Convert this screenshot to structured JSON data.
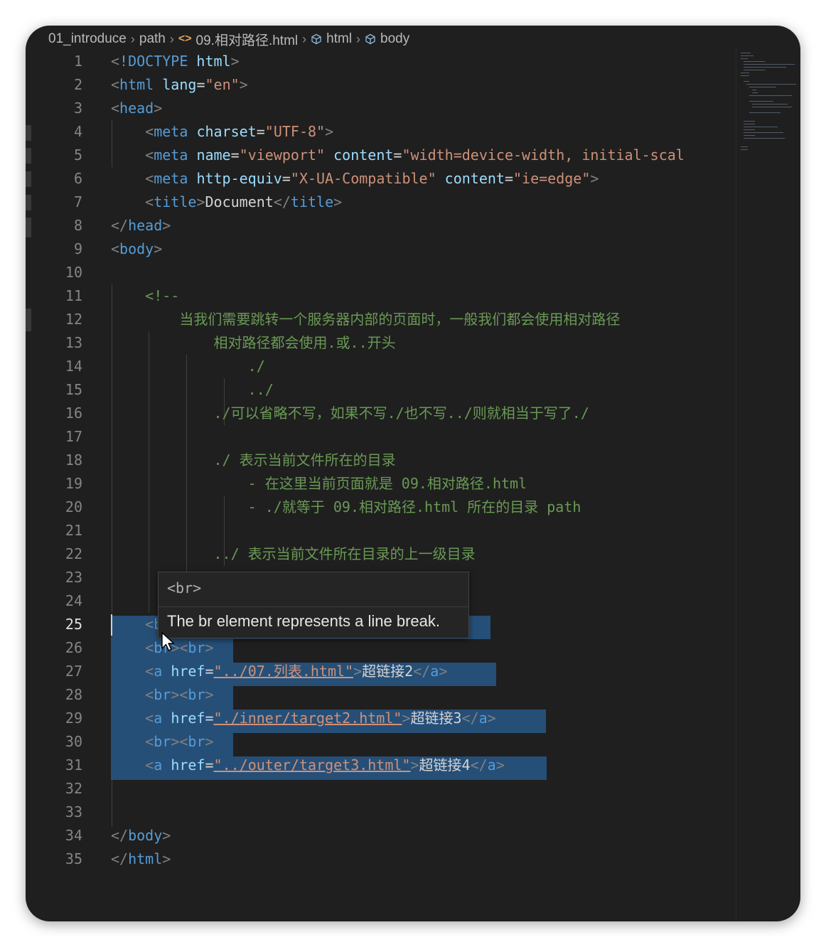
{
  "breadcrumb": {
    "items": [
      "01_introduce",
      "path",
      "09.相对路径.html",
      "html",
      "body"
    ]
  },
  "editor": {
    "active_line": 25,
    "lines": [
      {
        "n": "1"
      },
      {
        "n": "2"
      },
      {
        "n": "3"
      },
      {
        "n": "4"
      },
      {
        "n": "5"
      },
      {
        "n": "6"
      },
      {
        "n": "7"
      },
      {
        "n": "8"
      },
      {
        "n": "9"
      },
      {
        "n": "10"
      },
      {
        "n": "11"
      },
      {
        "n": "12"
      },
      {
        "n": "13"
      },
      {
        "n": "14"
      },
      {
        "n": "15"
      },
      {
        "n": "16"
      },
      {
        "n": "17"
      },
      {
        "n": "18"
      },
      {
        "n": "19"
      },
      {
        "n": "20"
      },
      {
        "n": "21"
      },
      {
        "n": "22"
      },
      {
        "n": "23"
      },
      {
        "n": "24"
      },
      {
        "n": "25"
      },
      {
        "n": "26"
      },
      {
        "n": "27"
      },
      {
        "n": "28"
      },
      {
        "n": "29"
      },
      {
        "n": "30"
      },
      {
        "n": "31"
      },
      {
        "n": "32"
      },
      {
        "n": "33"
      },
      {
        "n": "34"
      },
      {
        "n": "35"
      }
    ],
    "code": {
      "l1": [
        "<",
        "!DOCTYPE",
        " ",
        "html",
        ">"
      ],
      "l2": [
        "<",
        "html",
        " ",
        "lang",
        "=",
        "\"en\"",
        ">"
      ],
      "l3": [
        "<",
        "head",
        ">"
      ],
      "l4": [
        "    <",
        "meta",
        " ",
        "charset",
        "=",
        "\"UTF-8\"",
        ">"
      ],
      "l5": [
        "    <",
        "meta",
        " ",
        "name",
        "=",
        "\"viewport\"",
        " ",
        "content",
        "=",
        "\"width=device-width, initial-scal"
      ],
      "l6": [
        "    <",
        "meta",
        " ",
        "http-equiv",
        "=",
        "\"X-UA-Compatible\"",
        " ",
        "content",
        "=",
        "\"ie=edge\"",
        ">"
      ],
      "l7": [
        "    <",
        "title",
        ">",
        "Document",
        "</",
        "title",
        ">"
      ],
      "l8": [
        "</",
        "head",
        ">"
      ],
      "l9": [
        "<",
        "body",
        ">"
      ],
      "l11": "    <!--",
      "l12": "        当我们需要跳转一个服务器内部的页面时，一般我们都会使用相对路径",
      "l13": "            相对路径都会使用.或..开头",
      "l14": "                ./",
      "l15": "                ../",
      "l16": "            ./可以省略不写，如果不写./也不写../则就相当于写了./",
      "l18": "            ./ 表示当前文件所在的目录",
      "l19": "                - 在这里当前页面就是 09.相对路径.html",
      "l20": "                - ./就等于 09.相对路径.html 所在的目录 path",
      "l22": "            ../ 表示当前文件所在目录的上一级目录",
      "l25": [
        "    <",
        "br",
        "><",
        "br",
        ">"
      ],
      "l26": [
        "    <",
        "br",
        "><",
        "br",
        ">"
      ],
      "l27": [
        "    <",
        "a",
        " ",
        "href",
        "=",
        "\"../07.列表.html\"",
        ">",
        "超链接2",
        "</",
        "a",
        ">"
      ],
      "l28": [
        "    <",
        "br",
        "><",
        "br",
        ">"
      ],
      "l29": [
        "    <",
        "a",
        " ",
        "href",
        "=",
        "\"./inner/target2.html\"",
        ">",
        "超链接3",
        "</",
        "a",
        ">"
      ],
      "l30": [
        "    <",
        "br",
        "><",
        "br",
        ">"
      ],
      "l31": [
        "    <",
        "a",
        " ",
        "href",
        "=",
        "\"../outer/target3.html\"",
        ">",
        "超链接4",
        "</",
        "a",
        ">"
      ],
      "l34": [
        "</",
        "body",
        ">"
      ],
      "l35": [
        "</",
        "html",
        ">"
      ]
    }
  },
  "tooltip": {
    "header": "<br>",
    "description": "The br element represents a line break."
  },
  "colors": {
    "background": "#1f1f1f",
    "tag": "#569cd6",
    "attribute": "#9cdcfe",
    "string": "#ce9178",
    "comment": "#6a9955",
    "selection": "#264f78"
  }
}
